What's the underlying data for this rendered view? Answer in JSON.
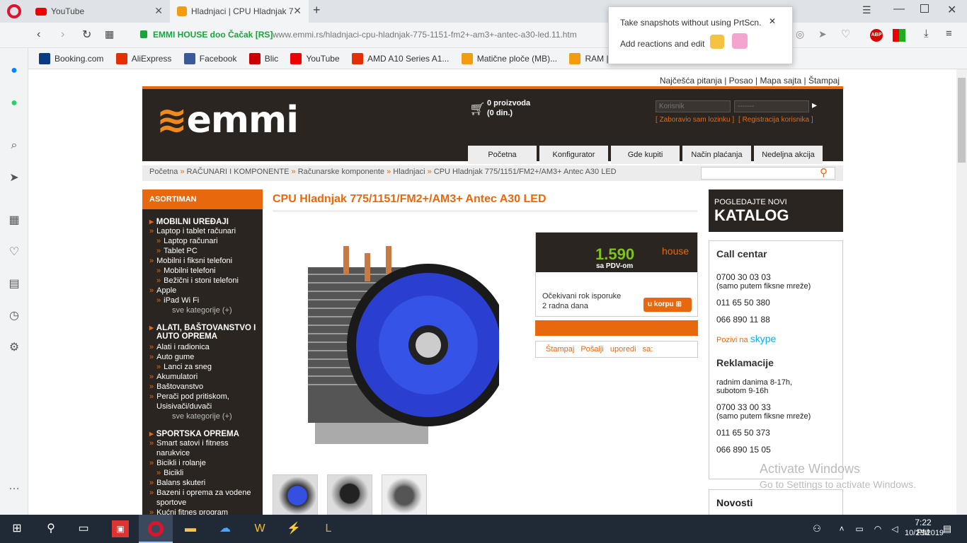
{
  "browser": {
    "tabs": [
      {
        "label": "YouTube",
        "active": false
      },
      {
        "label": "Hladnjaci | CPU Hladnjak 77",
        "active": true
      }
    ],
    "new_tab": "+",
    "site_name": "EMMI HOUSE doo Čačak [RS]",
    "url": "www.emmi.rs/hladnjaci-cpu-hladnjak-775-1151-fm2+-am3+-antec-a30-led.11.htm",
    "bookmarks": [
      "Booking.com",
      "AliExpress",
      "Facebook",
      "Blic",
      "YouTube",
      "AMD A10 Series A1...",
      "Matične ploče (MB)...",
      "RAM | Mem"
    ],
    "popup": {
      "line1": "Take snapshots without using PrtScn.",
      "line2": "Add reactions and edit"
    }
  },
  "site": {
    "top_links": "Najčešća pitanja | Posao | Mapa sajta | Štampaj",
    "logo": "emmi",
    "cart_count": "0 proizvoda",
    "cart_total": "(0 din.)",
    "login_user_placeholder": "Korisnik",
    "login_pass_placeholder": "-------",
    "forgot": "Zaboravio sam lozinku",
    "register": "Registracija korisnika",
    "nav": [
      "Početna",
      "Konfigurator",
      "Gde kupiti",
      "Način plaćanja",
      "Nedeljna akcija"
    ],
    "breadcrumbs": [
      "Početna",
      "RAČUNARI I KOMPONENTE",
      "Računarske komponente",
      "Hladnjaci",
      "CPU Hladnjak 775/1151/FM2+/AM3+ Antec A30 LED"
    ],
    "sidebar": {
      "title": "ASORTIMAN",
      "cat1": "MOBILNI UREĐAJI",
      "items1": [
        "Laptop i tablet računari",
        "Laptop računari",
        "Tablet PC",
        "Mobilni i fiksni telefoni",
        "Mobilni telefoni",
        "Bežični i stoni telefoni",
        "Apple",
        "iPad Wi Fi"
      ],
      "more": "sve kategorije (+)",
      "cat2a": "ALATI, BAŠTOVANSTVO I",
      "cat2b": "AUTO OPREMA",
      "items2": [
        "Alati i radionica",
        "Auto gume",
        "Lanci za sneg",
        "Akumulatori",
        "Baštovanstvo",
        "Perači pod pritiskom,",
        "Usisivači/duvači"
      ],
      "cat3": "SPORTSKA OPREMA",
      "items3": [
        "Smart satovi i fitness",
        "narukvice",
        "Bicikli i rolanje",
        "Bicikli",
        "Balans skuteri",
        "Bazeni i oprema za vodene",
        "sportove",
        "Kućni fitnes program"
      ]
    },
    "product": {
      "title": "CPU Hladnjak 775/1151/FM2+/AM3+ Antec A30 LED",
      "price": "1.590",
      "price_note": "sa PDV-om",
      "house": "house",
      "delivery_label": "Očekivani rok isporuke",
      "delivery_value": "2 radna dana",
      "cart_button": "u korpu",
      "actions": "Štampaj Pošalji uporedi sa:"
    },
    "right": {
      "katalog_small": "POGLEDAJTE NOVI",
      "katalog_big": "KATALOG",
      "call_title": "Call centar",
      "phone1": "0700 30 03 03",
      "phone1_note": "(samo putem fiksne mreže)",
      "phone2": "011 65 50 380",
      "phone3": "066 890 11 88",
      "skype_pre": "Pozivi na",
      "skype": "skype",
      "rek_title": "Reklamacije",
      "hours1": "radnim danima 8-17h,",
      "hours2": "subotom 9-16h",
      "phone4": "0700 33 00 33",
      "phone4_note": "(samo putem fiksne mreže)",
      "phone5": "011 65 50 373",
      "phone6": "066 890 15 05",
      "novosti": "Novosti"
    }
  },
  "watermark": {
    "line1": "Activate Windows",
    "line2": "Go to Settings to activate Windows."
  },
  "taskbar": {
    "time": "7:22 PM",
    "date": "10/23/2019"
  }
}
